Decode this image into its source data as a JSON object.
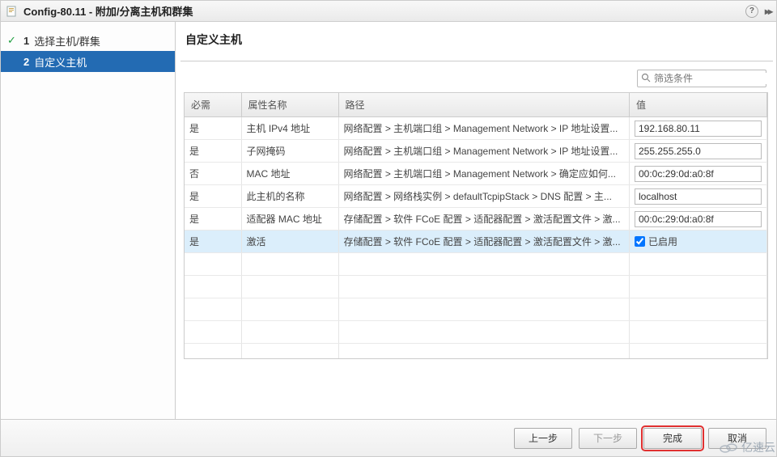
{
  "title": "Config-80.11 - 附加/分离主机和群集",
  "sidebar": {
    "steps": [
      {
        "num": "1",
        "label": "选择主机/群集",
        "checked": true
      },
      {
        "num": "2",
        "label": "自定义主机",
        "active": true
      }
    ]
  },
  "page_heading": "自定义主机",
  "filter_placeholder": "筛选条件",
  "table": {
    "headers": {
      "required": "必需",
      "attr": "属性名称",
      "path": "路径",
      "value": "值"
    },
    "rows": [
      {
        "required": "是",
        "attr": "主机 IPv4 地址",
        "path": "网络配置 > 主机端口组 > Management Network > IP 地址设置...",
        "value": "192.168.80.11",
        "type": "text"
      },
      {
        "required": "是",
        "attr": "子网掩码",
        "path": "网络配置 > 主机端口组 > Management Network > IP 地址设置...",
        "value": "255.255.255.0",
        "type": "text"
      },
      {
        "required": "否",
        "attr": "MAC 地址",
        "path": "网络配置 > 主机端口组 > Management Network > 确定应如何...",
        "value": "00:0c:29:0d:a0:8f",
        "type": "text"
      },
      {
        "required": "是",
        "attr": "此主机的名称",
        "path": "网络配置 > 网络栈实例 > defaultTcpipStack > DNS 配置 > 主...",
        "value": "localhost",
        "type": "text"
      },
      {
        "required": "是",
        "attr": "适配器 MAC 地址",
        "path": "存储配置 > 软件 FCoE 配置 > 适配器配置 > 激活配置文件 > 激...",
        "value": "00:0c:29:0d:a0:8f",
        "type": "text"
      },
      {
        "required": "是",
        "attr": "激活",
        "path": "存储配置 > 软件 FCoE 配置 > 适配器配置 > 激活配置文件 > 激...",
        "value": "已启用",
        "type": "checkbox",
        "checked": true,
        "selected": true
      }
    ]
  },
  "buttons": {
    "back": "上一步",
    "next": "下一步",
    "finish": "完成",
    "cancel": "取消"
  },
  "watermark": "亿速云"
}
